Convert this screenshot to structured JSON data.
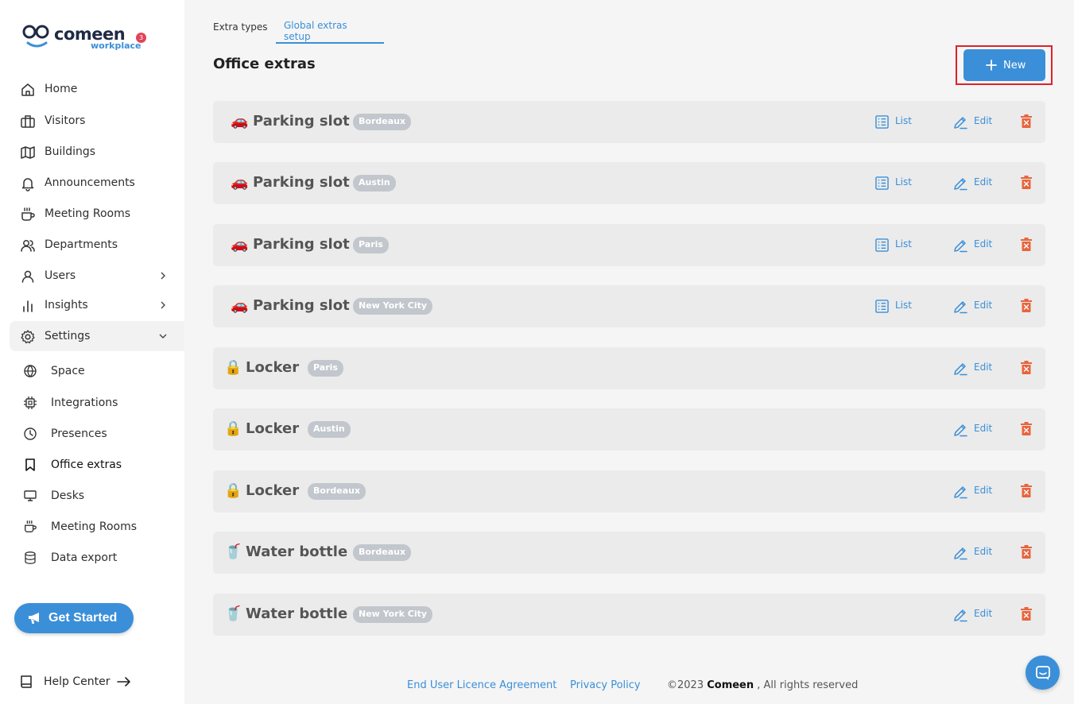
{
  "brand": {
    "name": "comeen",
    "sub": "workplace",
    "notification_count": "3",
    "accent_color": "#3a8fd8"
  },
  "sidebar": {
    "items": [
      {
        "label": "Home",
        "icon": "home-icon"
      },
      {
        "label": "Visitors",
        "icon": "briefcase-icon"
      },
      {
        "label": "Buildings",
        "icon": "map-icon"
      },
      {
        "label": "Announcements",
        "icon": "bell-icon"
      },
      {
        "label": "Meeting Rooms",
        "icon": "coffee-icon"
      },
      {
        "label": "Departments",
        "icon": "users-icon"
      },
      {
        "label": "Users",
        "icon": "user-icon"
      },
      {
        "label": "Insights",
        "icon": "bar-chart-icon"
      },
      {
        "label": "Settings",
        "icon": "gear-icon"
      }
    ],
    "settings_sub": [
      {
        "label": "Space",
        "icon": "globe-icon"
      },
      {
        "label": "Integrations",
        "icon": "chip-icon"
      },
      {
        "label": "Presences",
        "icon": "clock-icon"
      },
      {
        "label": "Office extras",
        "icon": "bookmark-icon"
      },
      {
        "label": "Desks",
        "icon": "monitor-icon"
      },
      {
        "label": "Meeting Rooms",
        "icon": "coffee-icon"
      },
      {
        "label": "Data export",
        "icon": "database-icon"
      }
    ],
    "get_started": "Get Started",
    "help_center": "Help Center"
  },
  "tabs": {
    "extra_types": "Extra types",
    "global_setup": "Global extras setup"
  },
  "page": {
    "title": "Office extras",
    "new_button": "New"
  },
  "actions": {
    "list": "List",
    "edit": "Edit"
  },
  "extras": [
    {
      "emoji": "🚗",
      "name": "Parking slot",
      "location": "Bordeaux"
    },
    {
      "emoji": "🚗",
      "name": "Parking slot",
      "location": "Austin"
    },
    {
      "emoji": "🚗",
      "name": "Parking slot",
      "location": "Paris"
    },
    {
      "emoji": "🚗",
      "name": "Parking slot",
      "location": "New York City"
    },
    {
      "emoji": "🔒",
      "name": "Locker",
      "location": "Paris"
    },
    {
      "emoji": "🔒",
      "name": "Locker",
      "location": "Austin"
    },
    {
      "emoji": "🔒",
      "name": "Locker",
      "location": "Bordeaux"
    },
    {
      "emoji": "🥤",
      "name": "Water bottle",
      "location": "Bordeaux"
    },
    {
      "emoji": "🥤",
      "name": "Water bottle",
      "location": "New York City"
    }
  ],
  "footer": {
    "eula": "End User Licence Agreement",
    "privacy": "Privacy Policy",
    "copyright_prefix": "©2023 ",
    "company": "Comeen",
    "copyright_suffix": " , All rights reserved"
  }
}
